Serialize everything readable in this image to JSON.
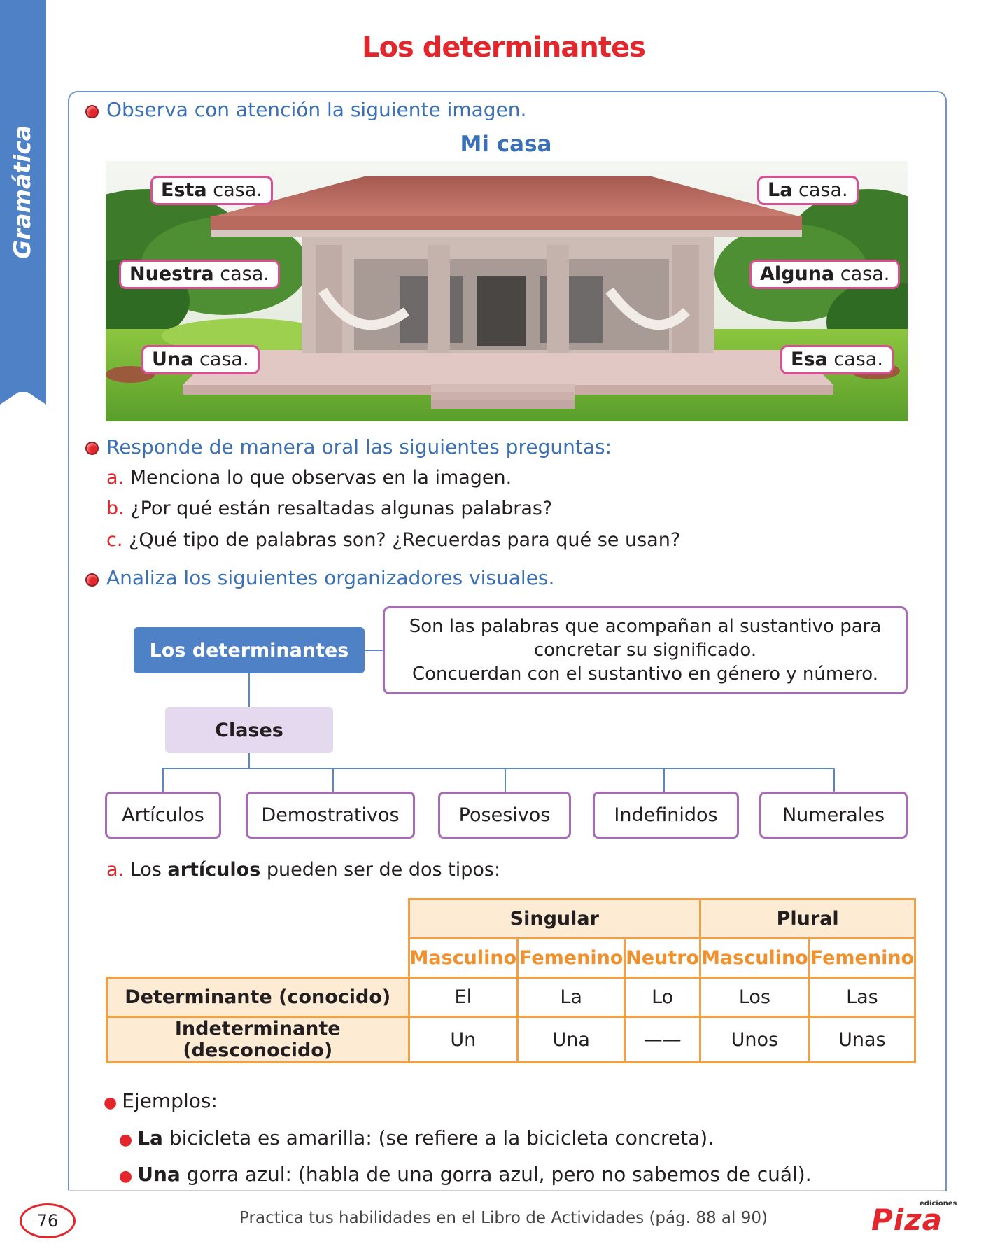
{
  "side_tab": "Gramática",
  "title": "Los determinantes",
  "instruction_1": "Observa con atención la siguiente imagen.",
  "picture_title": "Mi casa",
  "tags": [
    {
      "bold": "Esta",
      "rest": " casa."
    },
    {
      "bold": "La",
      "rest": " casa."
    },
    {
      "bold": "Nuestra",
      "rest": " casa."
    },
    {
      "bold": "Alguna",
      "rest": " casa."
    },
    {
      "bold": "Una",
      "rest": " casa."
    },
    {
      "bold": "Esa",
      "rest": " casa."
    }
  ],
  "instruction_2": "Responde de manera oral las siguientes preguntas:",
  "questions": [
    {
      "letter": "a.",
      "text": " Menciona lo que observas en la imagen."
    },
    {
      "letter": "b.",
      "text": " ¿Por qué están resaltadas algunas palabras?"
    },
    {
      "letter": "c.",
      "text": " ¿Qué tipo de palabras son? ¿Recuerdas para qué se usan?"
    }
  ],
  "instruction_3": "Analiza los siguientes organizadores visuales.",
  "organizer": {
    "main": "Los determinantes",
    "definition_1": "Son las palabras que acompañan al sustantivo para",
    "definition_2": "concretar su significado.",
    "definition_3": "Concuerdan con el sustantivo en género y número.",
    "clases": "Clases",
    "classes": [
      "Artículos",
      "Demostrativos",
      "Posesivos",
      "Indefinidos",
      "Numerales"
    ]
  },
  "articles_intro": {
    "letter": "a.",
    "pre": " Los ",
    "bold": "artículos",
    "post": " pueden ser de dos tipos:"
  },
  "table": {
    "group_headers": [
      "Singular",
      "Plural"
    ],
    "sub_headers": [
      "Masculino",
      "Femenino",
      "Neutro",
      "Masculino",
      "Femenino"
    ],
    "rows": [
      {
        "label": "Determinante (conocido)",
        "cells": [
          "El",
          "La",
          "Lo",
          "Los",
          "Las"
        ]
      },
      {
        "label": "Indeterminante (desconocido)",
        "cells": [
          "Un",
          "Una",
          "——",
          "Unos",
          "Unas"
        ]
      }
    ]
  },
  "examples_label": "Ejemplos:",
  "examples": [
    {
      "bold": "La",
      "rest": " bicicleta es amarilla: (se refiere a la bicicleta concreta)."
    },
    {
      "bold": "Una",
      "rest": " gorra azul: (habla de una gorra azul, pero no sabemos de cuál)."
    }
  ],
  "page_number": "76",
  "footer": "Practica tus habilidades en el Libro de Actividades (pág. 88 al 90)",
  "logo": "Piza",
  "logo_small": "ediciones"
}
